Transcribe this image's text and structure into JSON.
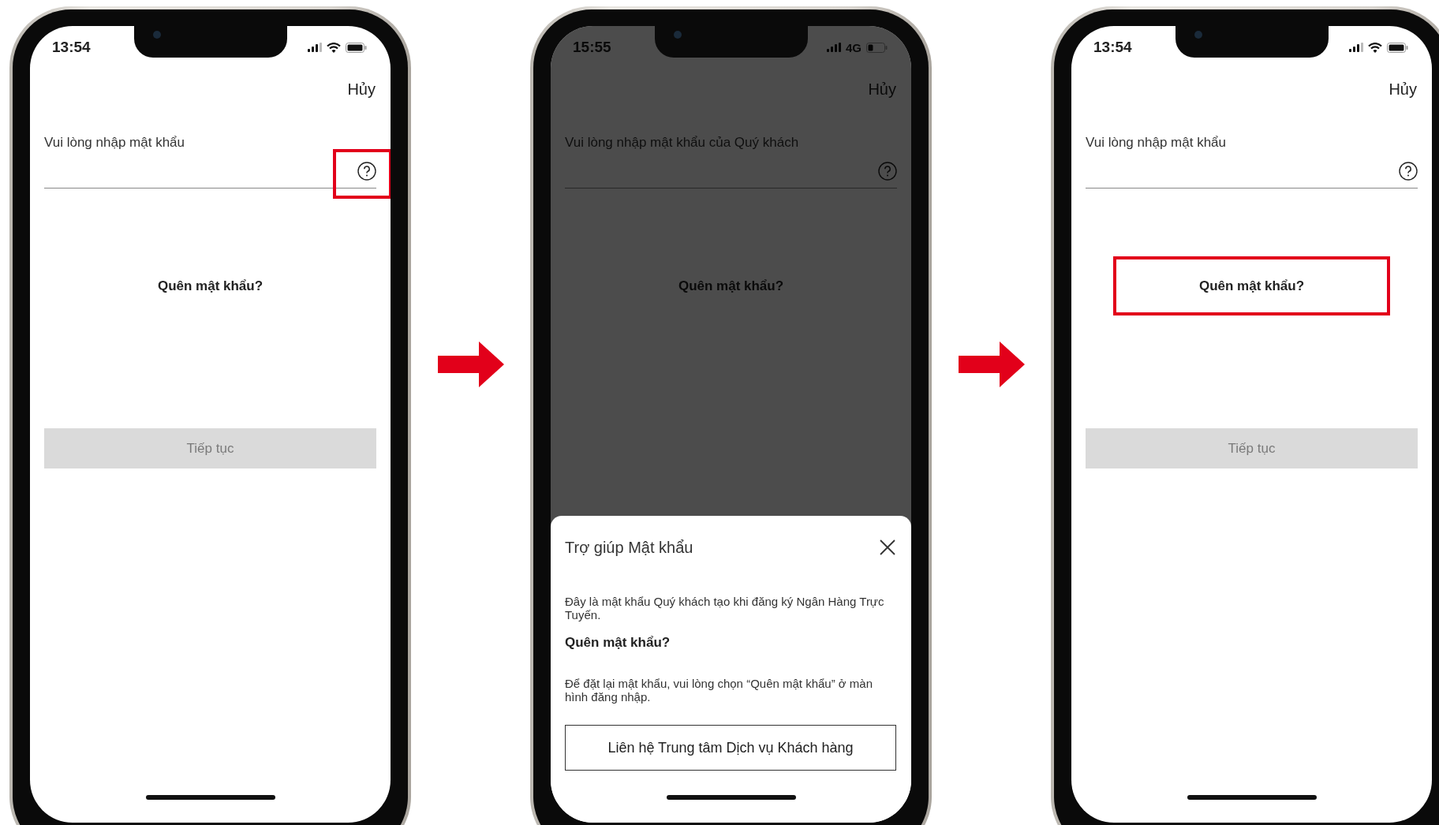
{
  "phones": [
    {
      "status": {
        "time": "13:54",
        "network": {
          "kind": "wifi"
        }
      },
      "cancel": "Hủy",
      "field": {
        "label": "Vui lòng nhập mật khẩu",
        "help_highlighted": true
      },
      "forgot_link": {
        "label": "Quên mật khẩu?",
        "highlighted": false
      },
      "continue_button": {
        "label": "Tiếp tục",
        "disabled": true
      },
      "dimmed": false
    },
    {
      "status": {
        "time": "15:55",
        "network": {
          "kind": "cellular",
          "label": "4G"
        }
      },
      "cancel": "Hủy",
      "field": {
        "label": "Vui lòng nhập mật khẩu của Quý khách",
        "help_highlighted": false
      },
      "forgot_link": {
        "label": "Quên mật khẩu?",
        "highlighted": false
      },
      "dimmed": true,
      "sheet": {
        "title": "Trợ giúp Mật khẩu",
        "intro": "Đây là mật khẩu Quý khách tạo khi đăng ký Ngân Hàng Trực Tuyến.",
        "subheading": "Quên mật khẩu?",
        "instructions": "Để đặt lại mật khẩu, vui lòng chọn “Quên mật khẩu” ở màn hình đăng nhập.",
        "contact_button": "Liên hệ Trung tâm Dịch vụ Khách hàng"
      }
    },
    {
      "status": {
        "time": "13:54",
        "network": {
          "kind": "wifi"
        }
      },
      "cancel": "Hủy",
      "field": {
        "label": "Vui lòng nhập mật khẩu",
        "help_highlighted": false
      },
      "forgot_link": {
        "label": "Quên mật khẩu?",
        "highlighted": true
      },
      "continue_button": {
        "label": "Tiếp tục",
        "disabled": true
      },
      "dimmed": false
    }
  ]
}
